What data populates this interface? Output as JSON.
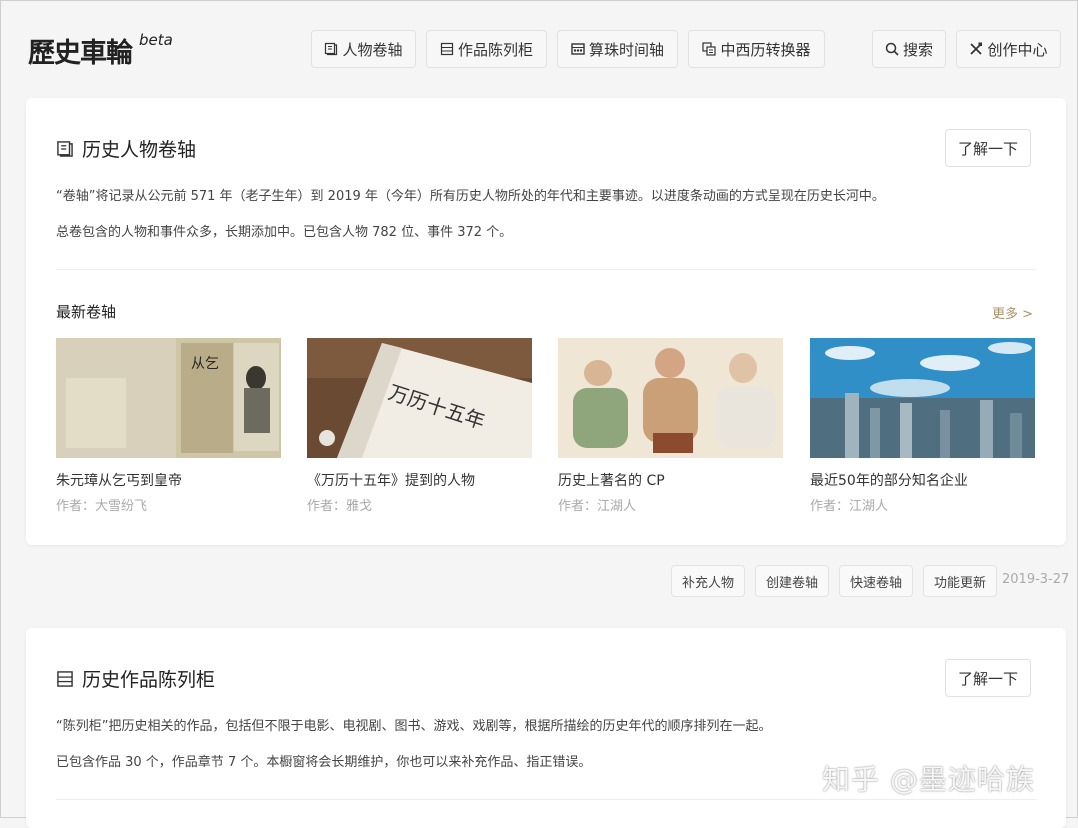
{
  "header": {
    "logo_text": "歷史車輪",
    "logo_suffix": "beta",
    "nav": [
      {
        "label": "人物卷轴",
        "icon": "scroll-icon"
      },
      {
        "label": "作品陈列柜",
        "icon": "cabinet-icon"
      },
      {
        "label": "算珠时间轴",
        "icon": "abacus-icon"
      },
      {
        "label": "中西历转换器",
        "icon": "calendar-convert-icon"
      }
    ],
    "search_label": "搜索",
    "creator_label": "创作中心"
  },
  "scroll_card": {
    "title": "历史人物卷轴",
    "learn_more": "了解一下",
    "desc1": "“卷轴”将记录从公元前 571 年（老子生年）到 2019 年（今年）所有历史人物所处的年代和主要事迹。以进度条动画的方式呈现在历史长河中。",
    "desc2": "总卷包含的人物和事件众多，长期添加中。已包含人物 782 位、事件 372 个。",
    "latest_title": "最新卷轴",
    "more": "更多 >",
    "items": [
      {
        "title": "朱元璋从乞丐到皇帝",
        "author": "作者：大雪纷飞"
      },
      {
        "title": "《万历十五年》提到的人物",
        "author": "作者：雅戈"
      },
      {
        "title": "历史上著名的 CP",
        "author": "作者：江湖人"
      },
      {
        "title": "最近50年的部分知名企业",
        "author": "作者：江湖人"
      }
    ]
  },
  "actions": {
    "buttons": [
      "补充人物",
      "创建卷轴",
      "快速卷轴",
      "功能更新"
    ],
    "date": "2019-3-27"
  },
  "cabinet_card": {
    "title": "历史作品陈列柜",
    "learn_more": "了解一下",
    "desc1": "“陈列柜”把历史相关的作品，包括但不限于电影、电视剧、图书、游戏、戏剧等，根据所描绘的历史年代的顺序排列在一起。",
    "desc2": "已包含作品 30 个，作品章节 7 个。本橱窗将会长期维护，你也可以来补充作品、指正错误。"
  },
  "watermark": "知乎 @墨迹哈族"
}
